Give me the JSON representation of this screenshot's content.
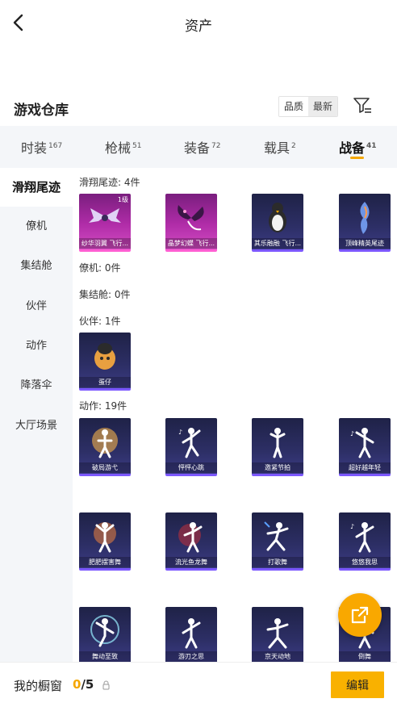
{
  "header": {
    "title": "资产",
    "back_icon": "chevron-left-icon"
  },
  "warehouse": {
    "title": "游戏仓库",
    "sort_options": [
      "品质",
      "最新"
    ],
    "sort_selected": "最新",
    "filter_icon": "filter-settings-icon"
  },
  "tabs": [
    {
      "label": "时装",
      "count": "167"
    },
    {
      "label": "枪械",
      "count": "51"
    },
    {
      "label": "装备",
      "count": "72"
    },
    {
      "label": "载具",
      "count": "2"
    },
    {
      "label": "战备",
      "count": "41",
      "active": true
    }
  ],
  "categories": [
    {
      "label": "滑翔尾迹",
      "active": true
    },
    {
      "label": "僚机"
    },
    {
      "label": "集结舱"
    },
    {
      "label": "伙伴"
    },
    {
      "label": "动作"
    },
    {
      "label": "降落伞"
    },
    {
      "label": "大厅场景"
    }
  ],
  "sections": {
    "glide": {
      "label": "滑翔尾迹: 4件",
      "items": [
        {
          "name": "纱华羽翼 飞行...",
          "level": "1级",
          "quality": "pink"
        },
        {
          "name": "晶梦幻蝶 飞行...",
          "quality": "pink"
        },
        {
          "name": "其乐融融 飞行...",
          "quality": "purple"
        },
        {
          "name": "顶峰精英尾迹",
          "quality": "purple"
        }
      ]
    },
    "wingman": {
      "label": "僚机: 0件"
    },
    "pod": {
      "label": "集结舱: 0件"
    },
    "partner": {
      "label": "伙伴: 1件",
      "items": [
        {
          "name": "蛋仔",
          "quality": "purple"
        }
      ]
    },
    "emote": {
      "label": "动作: 19件",
      "items": [
        {
          "name": "破局游弋"
        },
        {
          "name": "怦怦心跳"
        },
        {
          "name": "邀紧节拍"
        },
        {
          "name": "超好越年轻"
        },
        {
          "name": "肥肥摆害舞"
        },
        {
          "name": "流光鱼龙舞"
        },
        {
          "name": "打歌舞"
        },
        {
          "name": "悠悠我思"
        },
        {
          "name": "舞动至致"
        },
        {
          "name": "游刃之思"
        },
        {
          "name": "京天动地"
        },
        {
          "name": "倒舞"
        }
      ]
    }
  },
  "fab": {
    "icon": "share-external-icon"
  },
  "bottom": {
    "label": "我的橱窗",
    "current": "0",
    "total": "/5",
    "lock_icon": "lock-icon",
    "edit_label": "编辑"
  },
  "colors": {
    "accent": "#f9b100",
    "card_purple": "#2d2f66",
    "card_pink": "#b02ca8"
  }
}
